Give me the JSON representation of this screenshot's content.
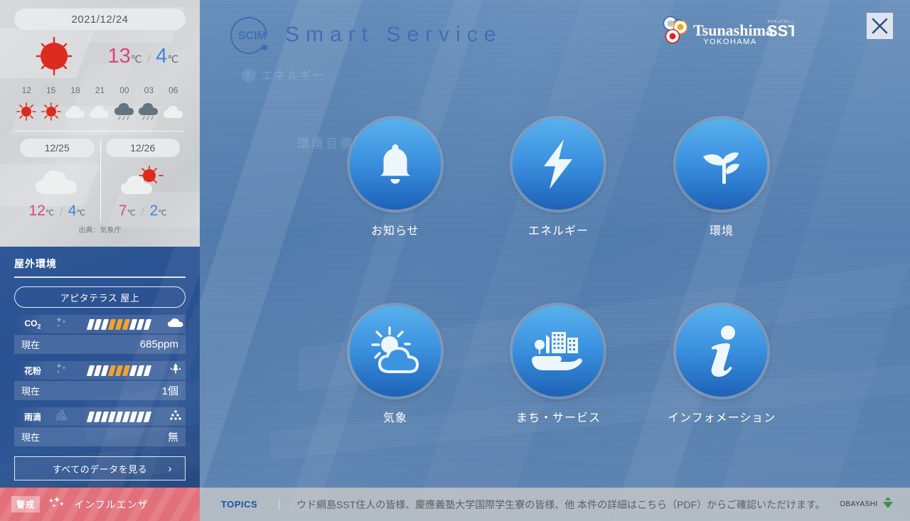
{
  "header": {
    "logo_text": "SCIM",
    "title": "Smart Service",
    "partner_logo": {
      "name": "TsunashimaSST",
      "sub": "YOKOHAMA",
      "tagline": "サスティナブル・スマートタウン"
    },
    "close_label": "×"
  },
  "background_ghost": {
    "energy_label": "エネルギー",
    "env_goal_label": "環境目標達成状況"
  },
  "weather": {
    "date": "2021/12/24",
    "today": {
      "icon": "sunny",
      "high": "13",
      "low": "4",
      "unit": "℃",
      "separator": "/"
    },
    "hourly": [
      {
        "hour": "12",
        "icon": "sunny"
      },
      {
        "hour": "15",
        "icon": "sunny"
      },
      {
        "hour": "18",
        "icon": "cloudy"
      },
      {
        "hour": "21",
        "icon": "cloudy"
      },
      {
        "hour": "00",
        "icon": "rainy"
      },
      {
        "hour": "03",
        "icon": "rainy"
      },
      {
        "hour": "06",
        "icon": "cloudy"
      }
    ],
    "days": [
      {
        "date": "12/25",
        "icon": "cloudy",
        "high": "12",
        "low": "4",
        "unit": "℃"
      },
      {
        "date": "12/26",
        "icon": "partly-sunny",
        "high": "7",
        "low": "2",
        "unit": "℃"
      }
    ],
    "source": "出典：気象庁",
    "colors": {
      "high": "#d5477f",
      "low": "#3f85e0",
      "unit": "#62666a"
    }
  },
  "outdoor": {
    "title": "屋外環境",
    "location": "アピタテラス 屋上",
    "metrics": [
      {
        "label": "CO",
        "sub": "2",
        "icon_left": "sparkle-icon",
        "icon_right": "cloud-icon",
        "bars_total": 9,
        "bars_on": [
          4,
          5,
          6
        ],
        "current_label": "現在",
        "value": "685ppm"
      },
      {
        "label": "花粉",
        "sub": "",
        "icon_left": "sparkle-icon",
        "icon_right": "tree-icon",
        "bars_total": 9,
        "bars_on": [
          4,
          5,
          6
        ],
        "current_label": "現在",
        "value": "1個"
      },
      {
        "label": "雨滴",
        "sub": "",
        "icon_left": "raindrops-icon",
        "icon_right": "raindrops-icon",
        "bars_total": 9,
        "bars_on": [],
        "current_label": "現在",
        "value": "無"
      }
    ],
    "all_data_button": "すべてのデータを見る",
    "chevron": "›",
    "accent_on": "#f0a32e"
  },
  "menu": {
    "items": [
      {
        "label": "お知らせ",
        "icon": "bell-icon"
      },
      {
        "label": "エネルギー",
        "icon": "lightning-bolt-icon"
      },
      {
        "label": "環境",
        "icon": "sprout-icon"
      },
      {
        "label": "気象",
        "icon": "sun-cloud-icon"
      },
      {
        "label": "まち・サービス",
        "icon": "hand-city-icon"
      },
      {
        "label": "インフォメーション",
        "icon": "info-icon"
      }
    ]
  },
  "bottom": {
    "alert_badge": "警戒",
    "alert_icon": "virus-icon",
    "alert_text": "インフルエンザ",
    "topics_label": "TOPICS",
    "topics_text": "ウド綱島SST住人の皆様、慶應義塾大学国際学生寮の皆様、他 本件の詳細はこちら（PDF）からご確認いただけます。",
    "company": "OBAYASHI",
    "company_icon": "obayashi-diamond-icon"
  }
}
